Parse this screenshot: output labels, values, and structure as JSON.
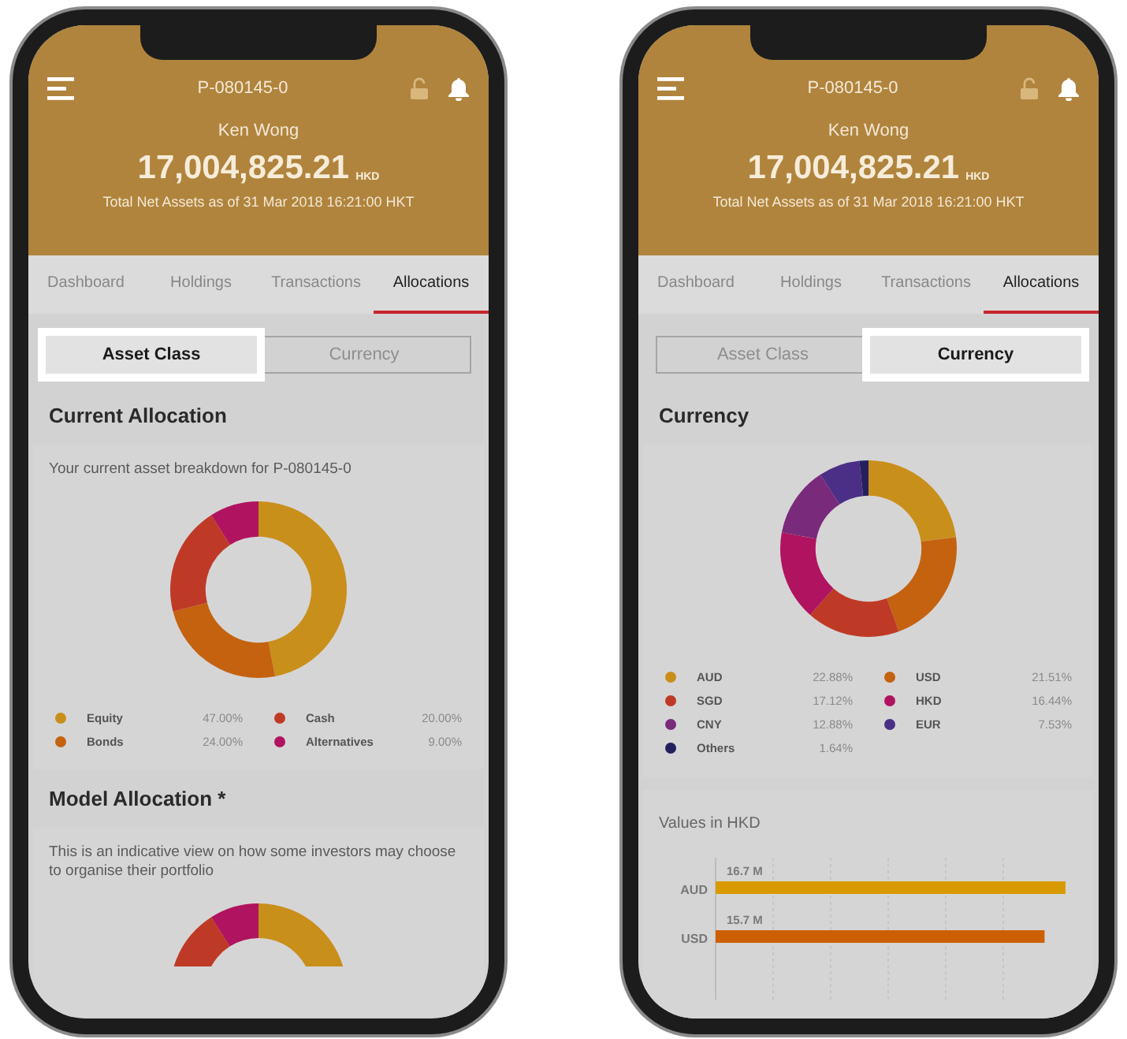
{
  "phones": [
    {
      "header": {
        "account": "P-080145-0",
        "name": "Ken Wong",
        "amount": "17,004,825.21",
        "currency": "HKD",
        "subtitle": "Total Net Assets as of 31 Mar 2018 16:21:00 HKT"
      },
      "tabs": [
        {
          "label": "Dashboard",
          "selected": false
        },
        {
          "label": "Holdings",
          "selected": false
        },
        {
          "label": "Transactions",
          "selected": false
        },
        {
          "label": "Allocations",
          "selected": true
        }
      ],
      "segments": [
        {
          "label": "Asset Class",
          "selected": true
        },
        {
          "label": "Currency",
          "selected": false
        }
      ],
      "sections": [
        {
          "kind": "donut",
          "title": "Current Allocation",
          "description": "Your current asset breakdown for P-080145-0",
          "legend_by_columns": true,
          "chart_data": {
            "type": "donut",
            "categories": [
              "Equity",
              "Bonds",
              "Cash",
              "Alternatives"
            ],
            "values": [
              47,
              24,
              20,
              9
            ],
            "value_labels": [
              "47.00%",
              "24.00%",
              "20.00%",
              "9.00%"
            ],
            "colors": [
              "#c98f1b",
              "#c4620f",
              "#bf3a26",
              "#b0135f"
            ]
          }
        },
        {
          "kind": "model",
          "title": "Model Allocation *",
          "description": "This is an indicative view on how some investors may choose to organise their portfolio"
        }
      ]
    },
    {
      "header": {
        "account": "P-080145-0",
        "name": "Ken Wong",
        "amount": "17,004,825.21",
        "currency": "HKD",
        "subtitle": "Total Net Assets as of 31 Mar 2018 16:21:00 HKT"
      },
      "tabs": [
        {
          "label": "Dashboard",
          "selected": false
        },
        {
          "label": "Holdings",
          "selected": false
        },
        {
          "label": "Transactions",
          "selected": false
        },
        {
          "label": "Allocations",
          "selected": true
        }
      ],
      "segments": [
        {
          "label": "Asset Class",
          "selected": false
        },
        {
          "label": "Currency",
          "selected": true
        }
      ],
      "sections": [
        {
          "kind": "donut",
          "title": "Currency",
          "legend_by_columns": false,
          "chart_data": {
            "type": "donut",
            "categories": [
              "AUD",
              "USD",
              "SGD",
              "HKD",
              "CNY",
              "EUR",
              "Others"
            ],
            "values": [
              22.88,
              21.51,
              17.12,
              16.44,
              12.88,
              7.53,
              1.64
            ],
            "value_labels": [
              "22.88%",
              "21.51%",
              "17.12%",
              "16.44%",
              "12.88%",
              "7.53%",
              "1.64%"
            ],
            "colors": [
              "#c98f1b",
              "#c4620f",
              "#bf3a26",
              "#b0135f",
              "#7a2a7a",
              "#4b2e86",
              "#24205e"
            ]
          }
        },
        {
          "kind": "bars",
          "subtitle": "Values in HKD",
          "chart_data": {
            "type": "bar",
            "orientation": "horizontal",
            "categories": [
              "AUD",
              "USD"
            ],
            "values": [
              16.7,
              15.7
            ],
            "data_labels": true,
            "value_labels": [
              "16.7 M",
              "15.7 M"
            ],
            "colors": [
              "#d99a00",
              "#cc6000"
            ]
          }
        }
      ]
    }
  ]
}
